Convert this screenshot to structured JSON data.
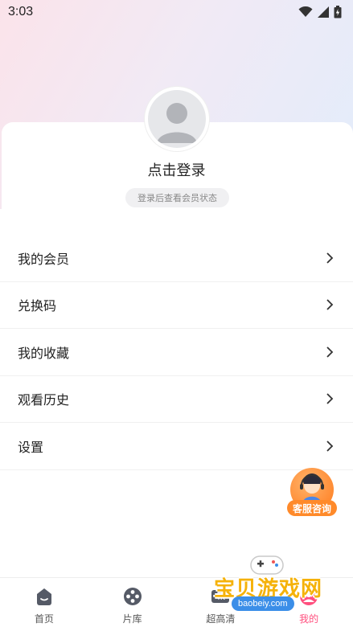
{
  "status_bar": {
    "time": "3:03",
    "icons": [
      "wifi-icon",
      "signal-icon",
      "battery-icon"
    ]
  },
  "profile": {
    "login_title": "点击登录",
    "login_hint": "登录后查看会员状态"
  },
  "menu": {
    "items": [
      {
        "label": "我的会员"
      },
      {
        "label": "兑换码"
      },
      {
        "label": "我的收藏"
      },
      {
        "label": "观看历史"
      },
      {
        "label": "设置"
      }
    ]
  },
  "service": {
    "label": "客服咨询"
  },
  "tabbar": {
    "tabs": [
      {
        "label": "首页",
        "icon": "home-icon"
      },
      {
        "label": "片库",
        "icon": "film-reel-icon"
      },
      {
        "label": "超高清",
        "icon": "hd-icon"
      },
      {
        "label": "我的",
        "icon": "profile-icon",
        "active": true
      }
    ]
  },
  "watermark": {
    "title": "宝贝游戏网",
    "url": "baobeiy.com"
  },
  "colors": {
    "accent": "#ff4f7e",
    "service": "#ff8a2a",
    "gradient_left": "#fbe3ea",
    "gradient_right": "#e2ecfb"
  }
}
